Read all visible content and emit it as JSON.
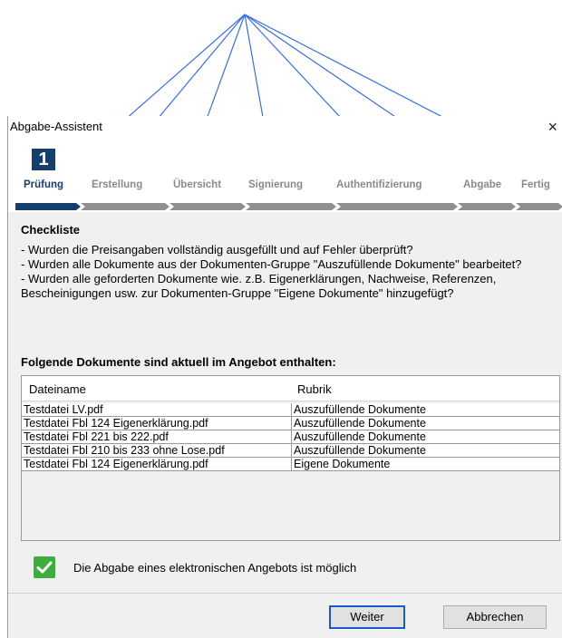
{
  "window": {
    "title": "Abgabe-Assistent",
    "close_glyph": "×"
  },
  "wizard": {
    "current_step_number": "1",
    "steps": [
      {
        "label": "Prüfung",
        "active": true
      },
      {
        "label": "Erstellung",
        "active": false
      },
      {
        "label": "Übersicht",
        "active": false
      },
      {
        "label": "Signierung",
        "active": false
      },
      {
        "label": "Authentifizierung",
        "active": false
      },
      {
        "label": "Abgabe",
        "active": false
      },
      {
        "label": "Fertig",
        "active": false
      }
    ],
    "active_color": "#173f6e",
    "inactive_color": "#8a8a8a"
  },
  "checklist": {
    "title": "Checkliste",
    "items": [
      "- Wurden die Preisangaben vollständig ausgefüllt und auf Fehler überprüft?",
      "- Wurden alle Dokumente aus der Dokumenten-Gruppe \"Auszufüllende Dokumente\" bearbeitet?",
      "- Wurden alle geforderten Dokumente wie. z.B. Eigenerklärungen, Nachweise, Referenzen, Bescheinigungen usw. zur Dokumenten-Gruppe \"Eigene Dokumente\" hinzugefügt?"
    ]
  },
  "documents": {
    "title": "Folgende Dokumente sind aktuell im Angebot enthalten:",
    "columns": [
      "Dateiname",
      "Rubrik"
    ],
    "rows": [
      [
        "Testdatei LV.pdf",
        "Auszufüllende Dokumente"
      ],
      [
        "Testdatei Fbl 124 Eigenerklärung.pdf",
        "Auszufüllende Dokumente"
      ],
      [
        "Testdatei Fbl 221 bis 222.pdf",
        "Auszufüllende Dokumente"
      ],
      [
        "Testdatei Fbl 210 bis 233 ohne Lose.pdf",
        "Auszufüllende Dokumente"
      ],
      [
        "Testdatei Fbl 124 Eigenerklärung.pdf",
        "Eigene Dokumente"
      ]
    ]
  },
  "status": {
    "checked": true,
    "text": "Die Abgabe eines elektronischen Angebots ist möglich",
    "color": "#3dad3b"
  },
  "buttons": {
    "next": "Weiter",
    "cancel": "Abbrechen"
  },
  "annotation": {
    "arrow_color": "#3a6fd8",
    "arrow_icon": "arrow-icon"
  }
}
